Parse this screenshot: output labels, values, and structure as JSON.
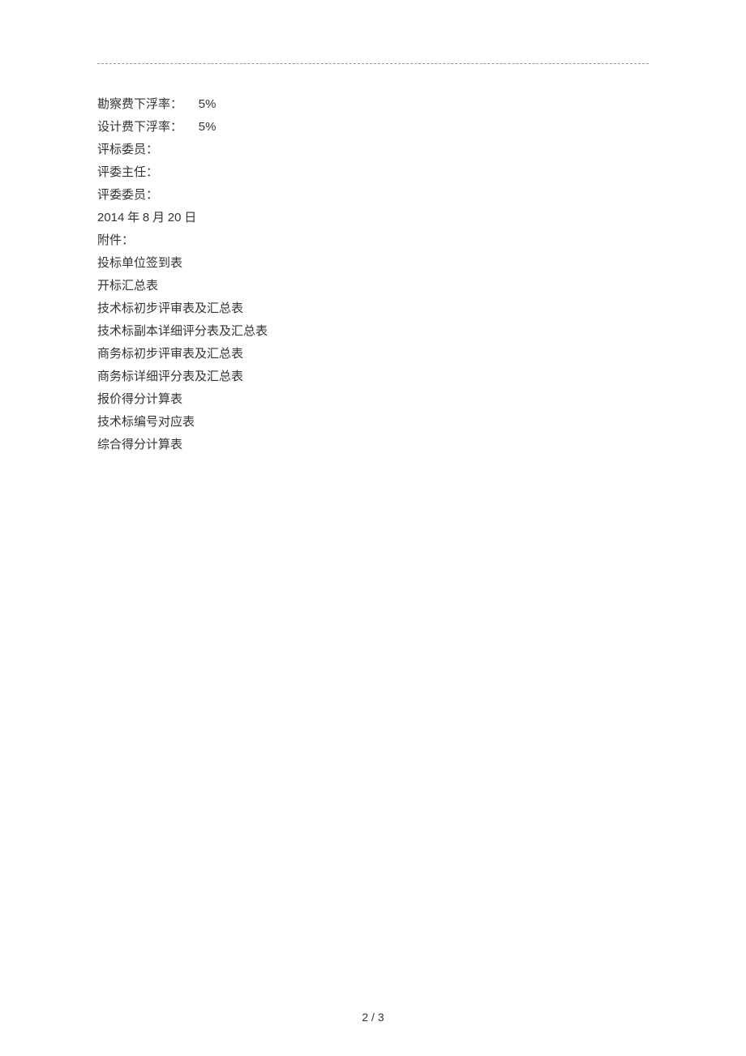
{
  "rates": {
    "survey_label": "勘察费下浮率：",
    "survey_value": "5%",
    "design_label": "设计费下浮率：",
    "design_value": "5%"
  },
  "committee": {
    "member_label": "评标委员：",
    "director_label": "评委主任：",
    "committee_label": "评委委员："
  },
  "date": {
    "year": "2014",
    "year_cn": " 年 ",
    "month": "8",
    "month_cn": " 月 ",
    "day": "20",
    "day_cn": " 日"
  },
  "attachments": {
    "header": "附件：",
    "items": [
      "投标单位签到表",
      "开标汇总表",
      "技术标初步评审表及汇总表",
      "技术标副本详细评分表及汇总表",
      "商务标初步评审表及汇总表",
      "商务标详细评分表及汇总表",
      "报价得分计算表",
      "技术标编号对应表",
      "综合得分计算表"
    ]
  },
  "footer": {
    "page_number": "2 / 3"
  }
}
